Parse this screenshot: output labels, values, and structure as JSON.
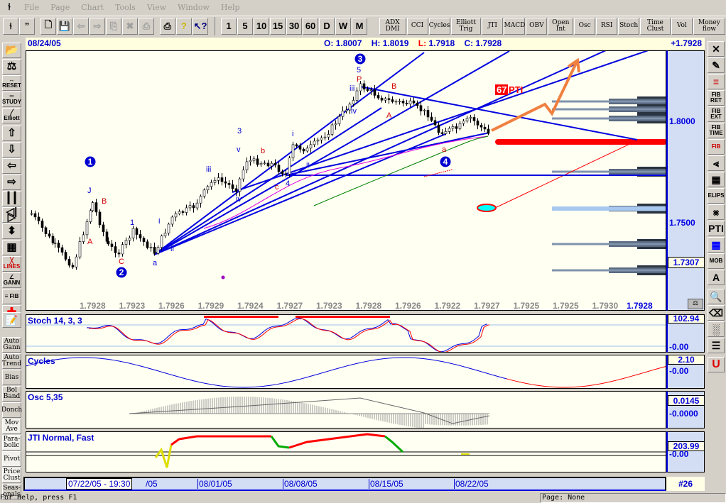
{
  "menu": [
    "File",
    "Page",
    "Chart",
    "Tools",
    "View",
    "Window",
    "Help"
  ],
  "toolbar": {
    "periods": [
      "1",
      "5",
      "10",
      "15",
      "30",
      "60",
      "D",
      "W",
      "M"
    ],
    "indicators": [
      "ADX DMI",
      "CCI",
      "Cycles",
      "Elliott Trig",
      "JTI",
      "MACD",
      "OBV",
      "Open Int",
      "Osc",
      "RSI",
      "Stoch",
      "Time Clust",
      "Vol",
      "Money flow"
    ]
  },
  "left_tools": [
    "open",
    "balance",
    "RESET",
    "STUDY",
    "Elliott",
    "up",
    "down",
    "left",
    "right",
    "bars",
    "expand-h",
    "expand-v",
    "grid",
    "LINES",
    "GANN",
    "FIB",
    "crosshair"
  ],
  "left_studies": [
    "Auto Gann",
    "Auto Trend",
    "Bias",
    "Bol Band",
    "Donch",
    "Mov Ave",
    "Para-bolic",
    "Pivot",
    "Price Clust",
    "Seas-onals"
  ],
  "right_tools": [
    "X",
    "pencil",
    "lines",
    "FIB RET",
    "FIB EXT",
    "FIB TIME",
    "FIB",
    "fan",
    "grid",
    "ELIPS",
    "pitchfork",
    "PTI",
    "table",
    "MOB",
    "A",
    "zoom",
    "eraser",
    "pattern",
    "report",
    "U"
  ],
  "header": {
    "date": "08/24/05",
    "open_label": "O:",
    "open": "1.8007",
    "high_label": "H:",
    "high": "1.8019",
    "low_label": "L:",
    "low": "1.7918",
    "close_label": "C:",
    "close": "1.7928",
    "change": "+1.7928"
  },
  "chart_data": {
    "type": "line",
    "price_axis": {
      "ticks": [
        "1.8000",
        "1.7500"
      ],
      "ylim": [
        1.71,
        1.836
      ],
      "current": "1.7307"
    },
    "price_path": [
      1.7545,
      1.7388,
      1.7283,
      1.7598,
      1.7388,
      1.7353,
      1.7458,
      1.7353,
      1.7528,
      1.758,
      1.772,
      1.7668,
      1.7808,
      1.779,
      1.7738,
      1.7878,
      1.786,
      1.7948,
      1.8087,
      1.8175,
      1.8105,
      1.8087,
      1.8035,
      1.7948,
      1.7965,
      1.8017,
      1.793
    ],
    "bottom_values": [
      "1.7928",
      "1.7923",
      "1.7926",
      "1.7929",
      "1.7924",
      "1.7927",
      "1.7923",
      "1.7928",
      "1.7926",
      "1.7922",
      "1.7927",
      "1.7925",
      "1.7925",
      "1.7930"
    ],
    "bottom_current": "1.7928",
    "wave_labels": [
      "1",
      "J",
      "B",
      "A",
      "C",
      "2",
      "1",
      "i",
      "ii",
      "iii",
      "iv",
      "3",
      "v",
      "b",
      "c",
      "4",
      "a",
      "i",
      "ii",
      "iii",
      "iv",
      "3",
      "5",
      "P",
      "B",
      "A",
      "4",
      "a"
    ],
    "pti": {
      "value": "67",
      "label": "PTI"
    }
  },
  "panes": {
    "stoch": {
      "title": "Stoch 14, 3, 3",
      "top": "102.94",
      "bottom": "-0.00"
    },
    "cycles": {
      "title": "Cycles",
      "top": "2.10",
      "bottom": "-0.00"
    },
    "osc": {
      "title": "Osc 5,35",
      "top": "0.0145",
      "bottom": "-0.0000"
    },
    "jti": {
      "title": "JTI Normal, Fast",
      "top": "203.99",
      "bottom": "-0.00"
    }
  },
  "datebar": {
    "cursor": "07/22/05 - 19:30",
    "dates": [
      "/05",
      "08/01/05",
      "08/08/05",
      "08/15/05",
      "08/22/05"
    ],
    "count": "#26"
  },
  "status": {
    "help": "For Help, press F1",
    "page": "Page: None"
  },
  "colors": {
    "accent": "#0000E0",
    "bg": "#FFFFF2",
    "axis": "#D3DEF5",
    "red": "#FF0000"
  }
}
